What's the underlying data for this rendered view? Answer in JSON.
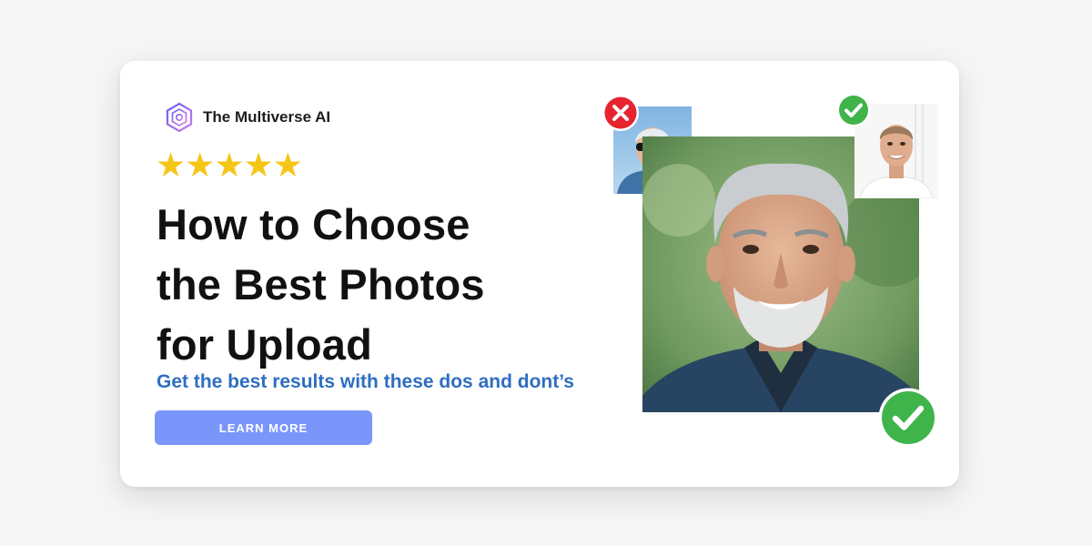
{
  "brand": {
    "name": "The Multiverse AI",
    "logo_icon": "hexagon-swirl-logo-icon"
  },
  "rating": {
    "value": 5,
    "max": 5,
    "icon": "star-icon",
    "color": "#f5c518"
  },
  "headline": {
    "lines": [
      "How to Choose",
      "the Best Photos",
      "for Upload"
    ]
  },
  "subtitle": "Get the best results with these dos and dont’s",
  "cta": {
    "label": "LEARN MORE",
    "color": "#7b96fb"
  },
  "photos": {
    "bad": {
      "status": "bad",
      "badge_icon": "red-x-icon",
      "badge_color": "#e5242f"
    },
    "good_small": {
      "status": "good",
      "badge_icon": "green-check-icon",
      "badge_color": "#3fb44a"
    },
    "main": {
      "status": "good",
      "badge_icon": "green-check-icon",
      "badge_color": "#3fb44a"
    }
  },
  "colors": {
    "subtitle": "#2f6ec0",
    "headline": "#111111",
    "card_bg": "#ffffff",
    "page_bg": "#f6f6f6"
  }
}
